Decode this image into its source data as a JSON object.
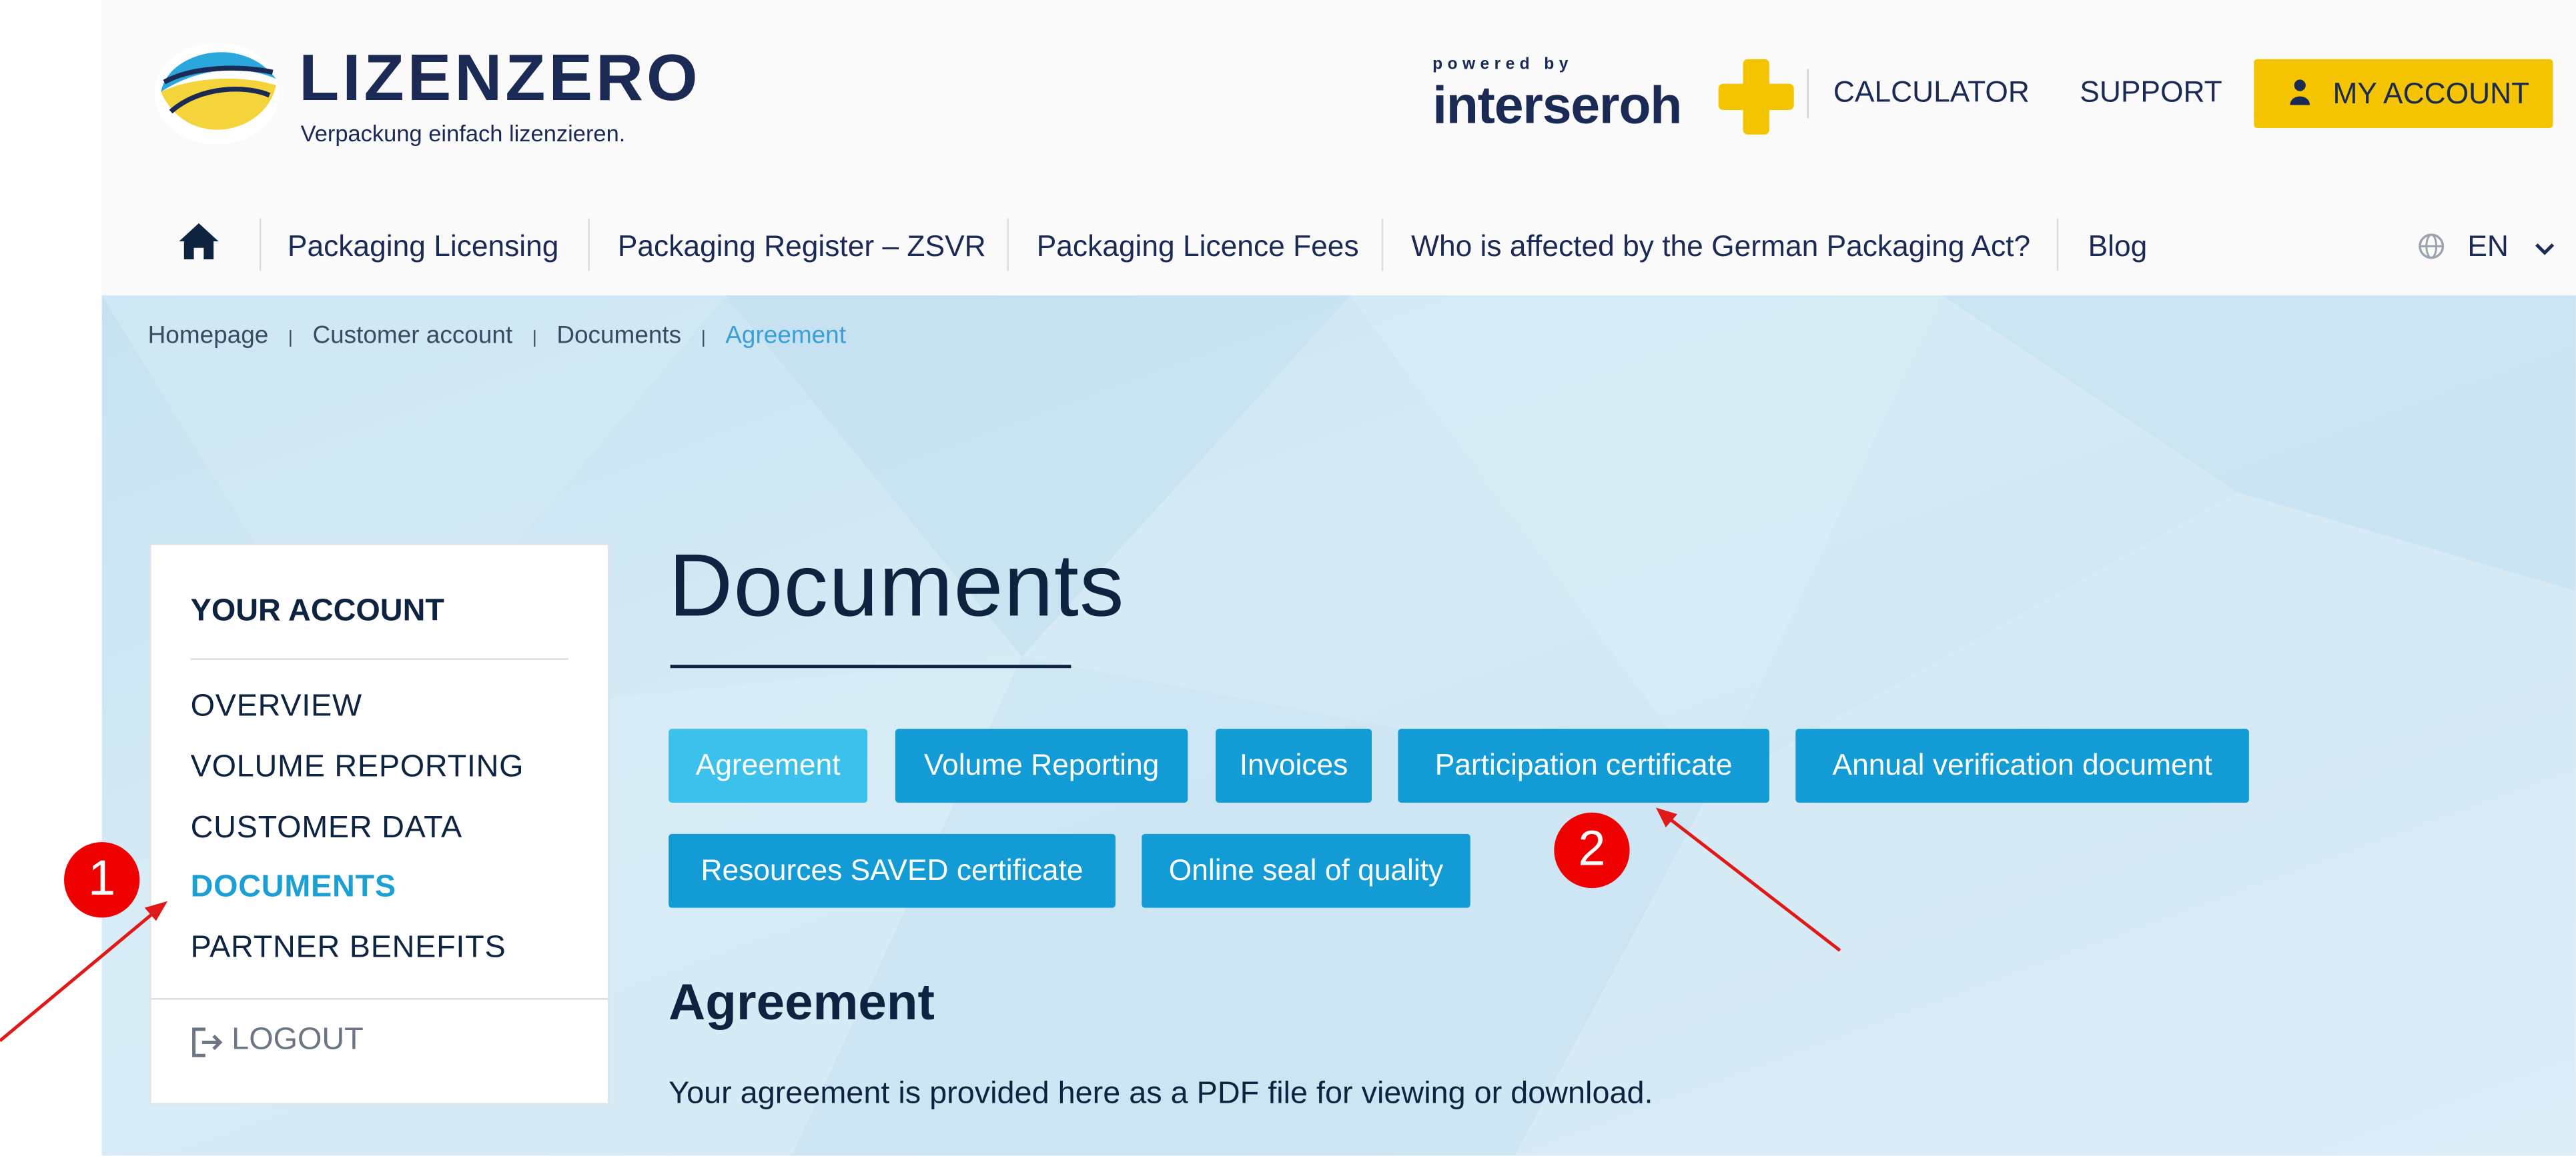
{
  "brand": {
    "name": "LIZENZERO",
    "tagline": "Verpackung einfach lizenzieren.",
    "colors": {
      "navy": "#1b2a55",
      "yellow": "#f5c400",
      "tab_blue": "#129bd4",
      "tab_selected": "#3cc0ec",
      "accent": "#1ba0d6"
    }
  },
  "partner": {
    "powered_label": "powered by",
    "name": "interseroh"
  },
  "topnav": {
    "calculator": "CALCULATOR",
    "support": "SUPPORT",
    "account": "MY ACCOUNT"
  },
  "mainnav": {
    "items": [
      "Packaging Licensing",
      "Packaging Register – ZSVR",
      "Packaging Licence Fees",
      "Who is affected by the German Packaging Act?",
      "Blog"
    ],
    "language": "EN"
  },
  "breadcrumb": [
    "Homepage",
    "Customer account",
    "Documents",
    "Agreement"
  ],
  "sidebar": {
    "heading": "YOUR ACCOUNT",
    "items": [
      "OVERVIEW",
      "VOLUME REPORTING",
      "CUSTOMER DATA",
      "DOCUMENTS",
      "PARTNER BENEFITS"
    ],
    "active": "DOCUMENTS",
    "logout": "LOGOUT"
  },
  "page": {
    "title": "Documents",
    "tabs": [
      "Agreement",
      "Volume Reporting",
      "Invoices",
      "Participation certificate",
      "Annual verification document",
      "Resources SAVED certificate",
      "Online seal of quality"
    ],
    "selected_tab": "Agreement",
    "section_title": "Agreement",
    "section_text": "Your agreement is provided here as a PDF file for viewing or download."
  },
  "annotations": {
    "marker_1": "1",
    "marker_2": "2",
    "color": "#ee0000"
  }
}
